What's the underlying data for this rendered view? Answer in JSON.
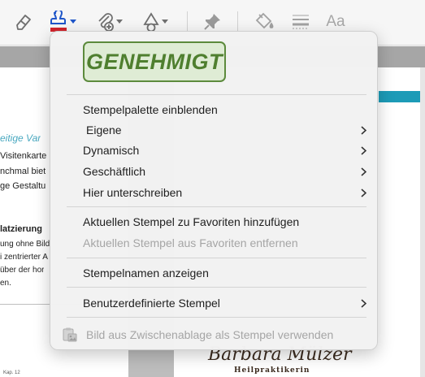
{
  "toolbar": {
    "icons": [
      "eraser-icon",
      "stamp-icon",
      "attach-icon",
      "shapes-icon",
      "pin-icon",
      "fill-icon",
      "line-style-icon",
      "font-icon"
    ],
    "font_label": "Aa",
    "stamp_accent": "#1f56c9",
    "stamp_ink": "#d2242c"
  },
  "document": {
    "left_page_lines": [
      "eitige Var",
      "Visitenkarte",
      "nchmal biet",
      "ge Gestaltu",
      "latzierung",
      "ung ohne Bild",
      "i zentrierter A",
      "über der hor",
      "en."
    ],
    "card_name": "Barbara Mülzer",
    "card_title": "Heilpraktikerin",
    "footer_note": "Kap. 12",
    "accent_color": "#1d9bb7"
  },
  "menu": {
    "stamp_preview": "GENEHMIGT",
    "stamp_color": "#4f7f2f",
    "items": [
      {
        "label": "Stempelpalette einblenden",
        "submenu": false,
        "enabled": true
      },
      {
        "label": "Eigene",
        "submenu": true,
        "enabled": true
      },
      {
        "label": "Dynamisch",
        "submenu": true,
        "enabled": true
      },
      {
        "label": "Geschäftlich",
        "submenu": true,
        "enabled": true
      },
      {
        "label": "Hier unterschreiben",
        "submenu": true,
        "enabled": true
      },
      {
        "label": "Aktuellen Stempel zu Favoriten hinzufügen",
        "submenu": false,
        "enabled": true
      },
      {
        "label": "Aktuellen Stempel aus Favoriten entfernen",
        "submenu": false,
        "enabled": false
      },
      {
        "label": "Stempelnamen anzeigen",
        "submenu": false,
        "enabled": true
      },
      {
        "label": "Benutzerdefinierte Stempel",
        "submenu": true,
        "enabled": true
      }
    ],
    "clipboard_item": {
      "label": "Bild aus Zwischenablage als Stempel verwenden",
      "enabled": false
    }
  }
}
